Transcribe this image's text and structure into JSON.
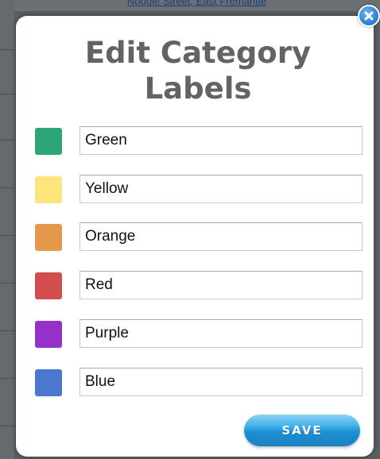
{
  "background_page": {
    "partial_link": "Noodle Street, East Fremantle"
  },
  "modal": {
    "title_line1": "Edit Category",
    "title_line2": "Labels",
    "close_icon": "close-icon",
    "labels": [
      {
        "value": "Green",
        "color": "#2ea576"
      },
      {
        "value": "Yellow",
        "color": "#fde47d"
      },
      {
        "value": "Orange",
        "color": "#e5984c"
      },
      {
        "value": "Red",
        "color": "#d24d4d"
      },
      {
        "value": "Purple",
        "color": "#9631c8"
      },
      {
        "value": "Blue",
        "color": "#4c77cf"
      }
    ],
    "save_label": "SAVE"
  },
  "colors": {
    "title": "#636363",
    "save_button": "#1c8fd2",
    "close_button": "#2d86d6"
  }
}
